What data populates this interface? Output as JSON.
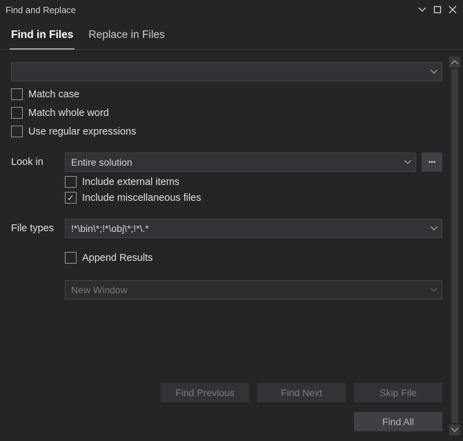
{
  "titlebar": {
    "title": "Find and Replace"
  },
  "tabs": {
    "find": "Find in Files",
    "replace": "Replace in Files"
  },
  "search": {
    "value": ""
  },
  "options": {
    "matchCase": "Match case",
    "matchWholeWord": "Match whole word",
    "useRegex": "Use regular expressions"
  },
  "lookIn": {
    "label": "Look in",
    "value": "Entire solution",
    "includeExternal": "Include external items",
    "includeMisc": "Include miscellaneous files"
  },
  "fileTypes": {
    "label": "File types",
    "value": "!*\\bin\\*;!*\\obj\\*;!*\\.*"
  },
  "results": {
    "append": "Append Results",
    "target": "New Window"
  },
  "actions": {
    "findPrevious": "Find Previous",
    "findNext": "Find Next",
    "skipFile": "Skip File",
    "findAll": "Find All"
  }
}
